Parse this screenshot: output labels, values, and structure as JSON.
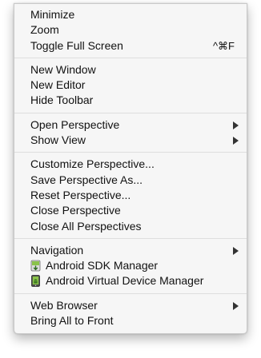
{
  "window_menu": {
    "group1": [
      {
        "label": "Minimize"
      },
      {
        "label": "Zoom"
      },
      {
        "label": "Toggle Full Screen",
        "shortcut": "^⌘F"
      }
    ],
    "group2": [
      {
        "label": "New Window"
      },
      {
        "label": "New Editor"
      },
      {
        "label": "Hide Toolbar"
      }
    ],
    "group3": [
      {
        "label": "Open Perspective"
      },
      {
        "label": "Show View"
      }
    ],
    "group4": [
      {
        "label": "Customize Perspective..."
      },
      {
        "label": "Save Perspective As..."
      },
      {
        "label": "Reset Perspective..."
      },
      {
        "label": "Close Perspective"
      },
      {
        "label": "Close All Perspectives"
      }
    ],
    "group5": [
      {
        "label": "Navigation"
      },
      {
        "label": "Android SDK Manager",
        "icon": "android-sdk-manager-icon"
      },
      {
        "label": "Android Virtual Device Manager",
        "icon": "android-avd-manager-icon"
      }
    ],
    "group6": [
      {
        "label": "Web Browser"
      },
      {
        "label": "Bring All to Front"
      }
    ]
  },
  "colors": {
    "menu_background": "#f6f6f6",
    "separator": "#dedede",
    "android_green": "#8bc34a",
    "text": "#111111"
  }
}
